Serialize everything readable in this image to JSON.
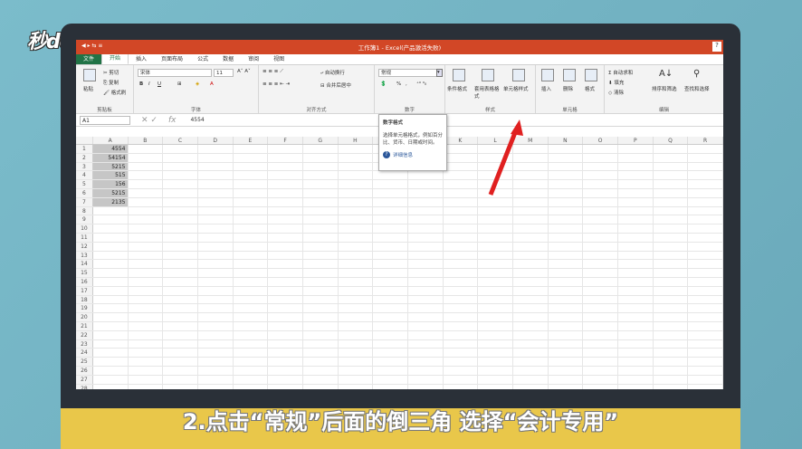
{
  "logo_text": "秒dong视频",
  "window": {
    "title": "工作簿1 - Excel(产品激活失败)",
    "help": "?",
    "quick_access": "◀ ▸ ⇆ ≡"
  },
  "tabs": [
    "文件",
    "开始",
    "插入",
    "页面布局",
    "公式",
    "数据",
    "审阅",
    "视图"
  ],
  "ribbon": {
    "clipboard": {
      "paste": "粘贴",
      "cut": "剪切",
      "copy": "复制",
      "format_painter": "格式刷",
      "label": "剪贴板"
    },
    "font": {
      "name": "宋体",
      "size": "11",
      "bold": "B",
      "italic": "I",
      "underline": "U",
      "label": "字体"
    },
    "alignment": {
      "wrap": "自动换行",
      "merge": "合并后居中",
      "label": "对齐方式"
    },
    "number": {
      "format": "常规",
      "percent": "%",
      "comma": ",",
      "label": "数字"
    },
    "styles": {
      "conditional": "条件格式",
      "table": "套用表格格式",
      "cell_styles": "单元格样式",
      "label": "样式"
    },
    "cells": {
      "insert": "插入",
      "delete": "删除",
      "format": "格式",
      "label": "单元格"
    },
    "editing": {
      "autosum": "自动求和",
      "fill": "填充",
      "clear": "清除",
      "sort": "排序和筛选",
      "find": "查找和选择",
      "label": "编辑"
    }
  },
  "formula_bar": {
    "name_box": "A1",
    "fx": "fx",
    "value": "4554"
  },
  "columns": [
    "A",
    "B",
    "C",
    "D",
    "E",
    "F",
    "G",
    "H",
    "I",
    "J",
    "K",
    "L",
    "M",
    "N",
    "O",
    "P",
    "Q",
    "R"
  ],
  "rows": [
    [
      "1",
      "4554"
    ],
    [
      "2",
      "54154"
    ],
    [
      "3",
      "5215"
    ],
    [
      "4",
      "515"
    ],
    [
      "5",
      "156"
    ],
    [
      "6",
      "5215"
    ],
    [
      "7",
      "2135"
    ],
    [
      "8",
      ""
    ],
    [
      "9",
      ""
    ],
    [
      "10",
      ""
    ],
    [
      "11",
      ""
    ],
    [
      "12",
      ""
    ],
    [
      "13",
      ""
    ],
    [
      "14",
      ""
    ],
    [
      "15",
      ""
    ],
    [
      "16",
      ""
    ],
    [
      "17",
      ""
    ],
    [
      "18",
      ""
    ],
    [
      "19",
      ""
    ],
    [
      "20",
      ""
    ],
    [
      "21",
      ""
    ],
    [
      "22",
      ""
    ],
    [
      "23",
      ""
    ],
    [
      "24",
      ""
    ],
    [
      "25",
      ""
    ],
    [
      "26",
      ""
    ],
    [
      "27",
      ""
    ],
    [
      "28",
      ""
    ]
  ],
  "tooltip": {
    "title": "数字格式",
    "body": "选择单元格格式，例如百分比、货币、日期或时间。",
    "link": "详细信息"
  },
  "caption": "2.点击“常规”后面的倒三角 选择“会计专用”"
}
